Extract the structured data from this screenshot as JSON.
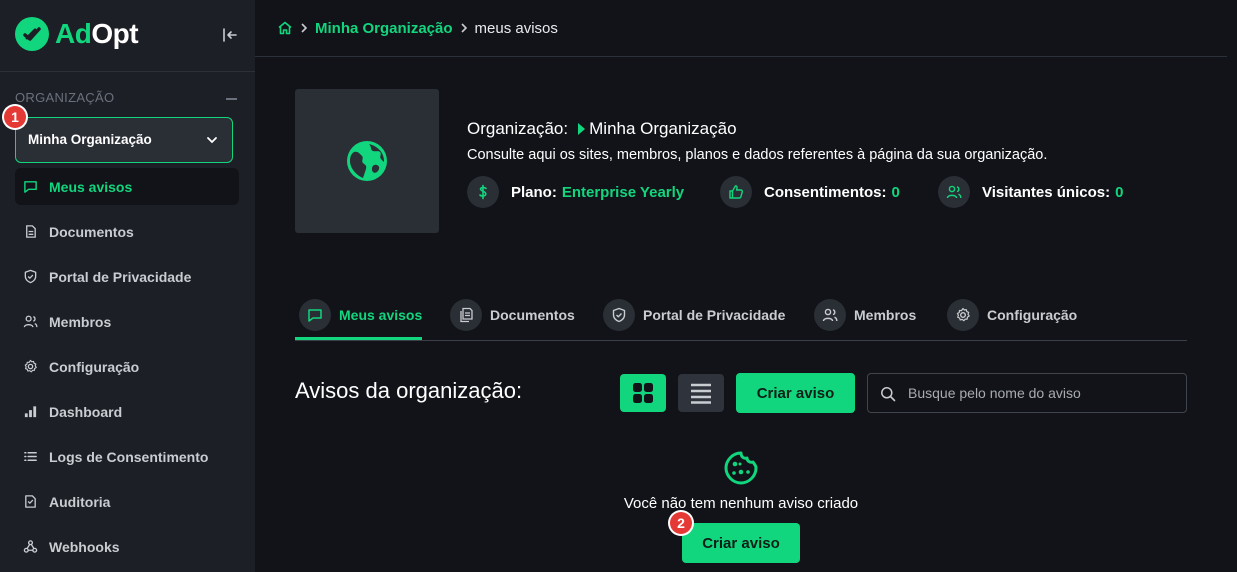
{
  "brand": {
    "name_part1": "Ad",
    "name_part2": "Opt",
    "accent": "#12d67e"
  },
  "sidebar": {
    "section_label": "ORGANIZAÇÃO",
    "org_select_value": "Minha Organização",
    "badge_1": "1",
    "items": [
      {
        "label": "Meus avisos",
        "icon": "chat-icon",
        "active": true
      },
      {
        "label": "Documentos",
        "icon": "document-icon"
      },
      {
        "label": "Portal de Privacidade",
        "icon": "shield-icon"
      },
      {
        "label": "Membros",
        "icon": "users-icon"
      },
      {
        "label": "Configuração",
        "icon": "gear-icon"
      },
      {
        "label": "Dashboard",
        "icon": "bar-chart-icon"
      },
      {
        "label": "Logs de Consentimento",
        "icon": "list-icon"
      },
      {
        "label": "Auditoria",
        "icon": "audit-icon"
      },
      {
        "label": "Webhooks",
        "icon": "webhook-icon"
      }
    ]
  },
  "breadcrumb": {
    "link": "Minha Organização",
    "current": "meus avisos"
  },
  "org": {
    "title_label": "Organização:",
    "title_value": "Minha Organização",
    "description": "Consulte aqui os sites, membros, planos e dados referentes à página da sua organização.",
    "plan_label": "Plano:",
    "plan_value": "Enterprise Yearly",
    "consents_label": "Consentimentos:",
    "consents_value": "0",
    "visitors_label": "Visitantes únicos:",
    "visitors_value": "0"
  },
  "tabs": [
    {
      "label": "Meus avisos",
      "active": true
    },
    {
      "label": "Documentos"
    },
    {
      "label": "Portal de Privacidade"
    },
    {
      "label": "Membros"
    },
    {
      "label": "Configuração"
    }
  ],
  "main": {
    "section_title": "Avisos da organização:",
    "create_label": "Criar aviso",
    "search_placeholder": "Busque pelo nome do aviso",
    "empty_text": "Você não tem nenhum aviso criado",
    "create_label_2": "Criar aviso",
    "badge_2": "2"
  }
}
